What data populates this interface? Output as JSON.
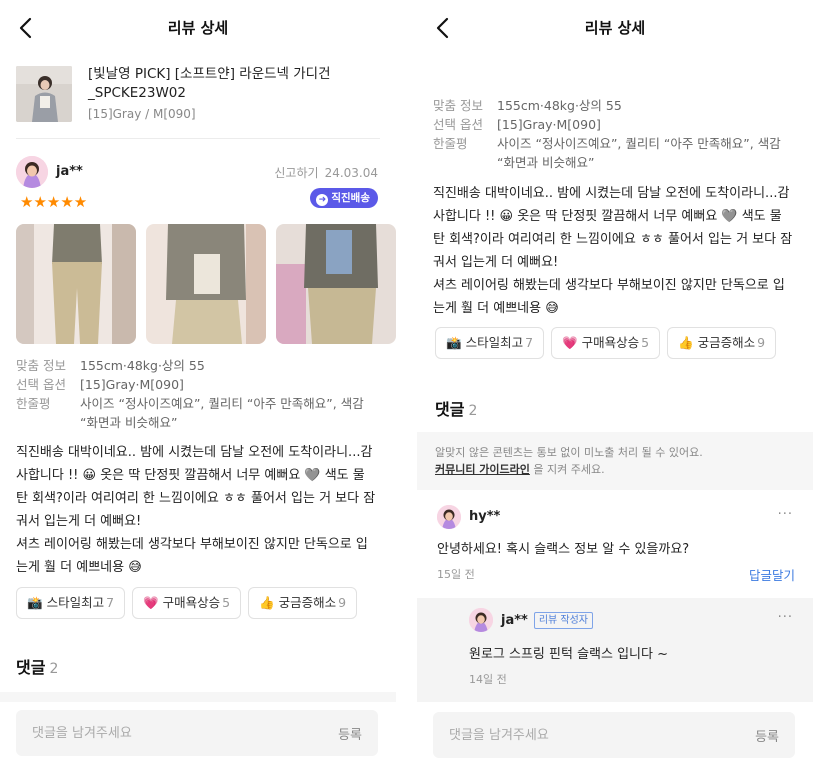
{
  "header": {
    "title": "리뷰 상세"
  },
  "product": {
    "name": "[빛날영 PICK] [소프트얀] 라운드넥 가디건 _SPCKE23W02",
    "option": "[15]Gray / M[090]"
  },
  "review": {
    "user": "ja**",
    "report_label": "신고하기",
    "date": "24.03.04",
    "rating": 5,
    "stars": "★★★★★",
    "badge": "직진배송",
    "info": [
      {
        "label": "맞춤 정보",
        "value": "155cm·48kg·상의 55"
      },
      {
        "label": "선택 옵션",
        "value": "[15]Gray·M[090]"
      },
      {
        "label": "한줄평",
        "value": "사이즈 “정사이즈예요”, 퀄리티 “아주 만족해요”, 색감 “화면과 비슷해요”"
      }
    ],
    "text_lines": [
      "직진배송 대박이네요.. 밤에 시켰는데 담날 오전에 도착이라니...감",
      "사합니다 !! 😀 옷은 딱 단정핏 깔끔해서 너무 예뻐요 🩶 색도 물",
      "탄 회색?이라 여리여리 한 느낌이에요 ㅎㅎ 풀어서 입는 거 보다 잠",
      "궈서 입는게 더 예뻐요!",
      "셔츠 레이어링 해봤는데 생각보다 부해보이진 않지만 단독으로 입",
      "는게 훨 더 예쁘네용 😅"
    ],
    "reactions": [
      {
        "icon": "📸",
        "label": "스타일최고",
        "count": "7"
      },
      {
        "icon": "💗",
        "label": "구매욕상승",
        "count": "5"
      },
      {
        "icon": "👍",
        "label": "궁금증해소",
        "count": "9"
      }
    ]
  },
  "comments": {
    "title": "댓글",
    "count": "2",
    "notice_line1": "알맞지 않은 콘텐츠는 통보 없이 미노출 처리 될 수 있어요.",
    "notice_link": "커뮤니티 가이드라인",
    "notice_tail": " 을 지켜 주세요.",
    "items": [
      {
        "user": "hy**",
        "text": "안녕하세요! 혹시 슬랙스 정보 알 수 있을까요?",
        "time": "15일 전",
        "reply_label": "답글달기",
        "more": "···"
      }
    ],
    "reply": {
      "user": "ja**",
      "tag": "리뷰 작성자",
      "text": "원로그 스프링 핀턱 슬랙스 입니다 ~",
      "time": "14일 전",
      "more": "···"
    }
  },
  "input": {
    "placeholder": "댓글을 남겨주세요",
    "submit": "등록"
  }
}
